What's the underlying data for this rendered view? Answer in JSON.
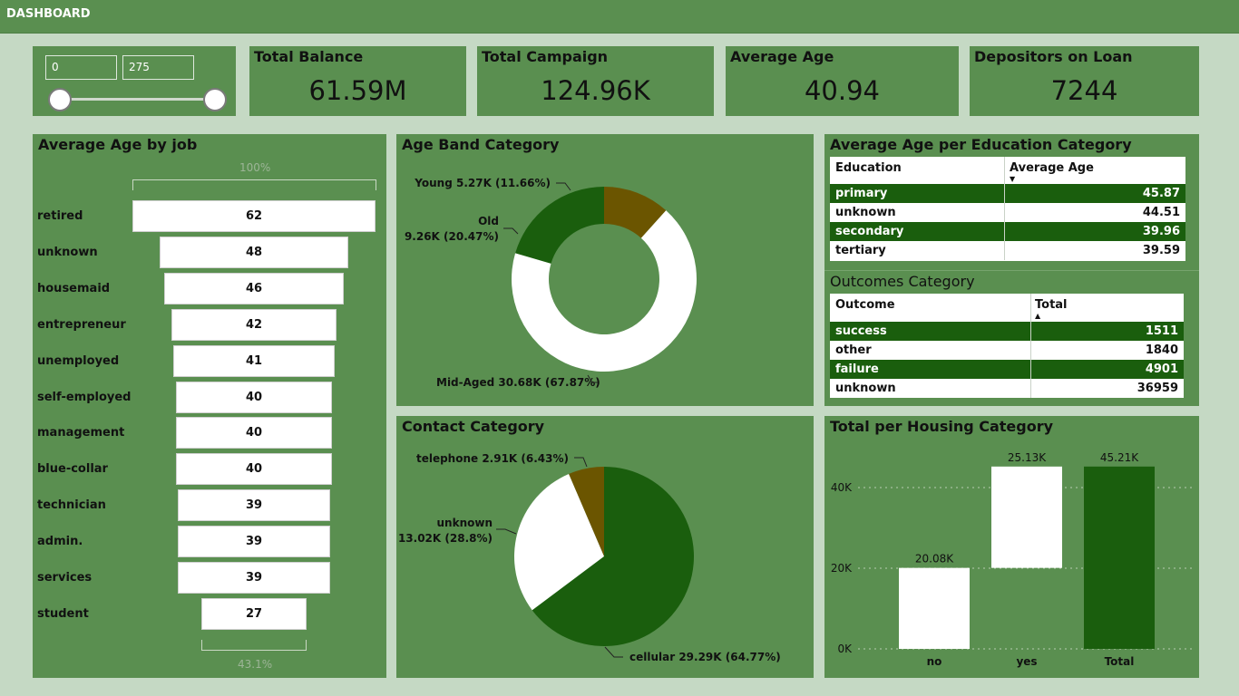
{
  "header": {
    "title": "DASHBOARD"
  },
  "range": {
    "min": "0",
    "max": "275"
  },
  "cards": [
    {
      "title": "Total Balance",
      "value": "61.59M"
    },
    {
      "title": "Total Campaign",
      "value": "124.96K"
    },
    {
      "title": "Average Age",
      "value": "40.94"
    },
    {
      "title": "Depositors on Loan",
      "value": "7244"
    }
  ],
  "colors": {
    "panel": "#5a8f50",
    "background": "#c5d9c4",
    "darkGreen": "#1a5e0d",
    "olive": "#6b5500",
    "white": "#ffffff"
  },
  "chart_data": [
    {
      "type": "funnel",
      "title": "Average Age by job",
      "top_percent": "100%",
      "bottom_percent": "43.1%",
      "categories": [
        "retired",
        "unknown",
        "housemaid",
        "entrepreneur",
        "unemployed",
        "self-employed",
        "management",
        "blue-collar",
        "technician",
        "admin.",
        "services",
        "student"
      ],
      "values": [
        62,
        48,
        46,
        42,
        41,
        40,
        40,
        40,
        39,
        39,
        39,
        27
      ]
    },
    {
      "type": "pie",
      "donut": true,
      "title": "Age Band Category",
      "slices": [
        {
          "name": "Young",
          "label": "Young 5.27K (11.66%)",
          "value": 5.27,
          "percent": 11.66,
          "color": "#6b5500"
        },
        {
          "name": "Mid-Aged",
          "label": "Mid-Aged 30.68K (67.87%)",
          "value": 30.68,
          "percent": 67.87,
          "color": "#ffffff"
        },
        {
          "name": "Old",
          "label_line1": "Old",
          "label_line2": "9.26K (20.47%)",
          "value": 9.26,
          "percent": 20.47,
          "color": "#1a5e0d"
        }
      ]
    },
    {
      "type": "pie",
      "title": "Contact Category",
      "slices": [
        {
          "name": "cellular",
          "label": "cellular 29.29K (64.77%)",
          "value": 29.29,
          "percent": 64.77,
          "color": "#1a5e0d"
        },
        {
          "name": "unknown",
          "label_line1": "unknown",
          "label_line2": "13.02K (28.8%)",
          "value": 13.02,
          "percent": 28.8,
          "color": "#ffffff"
        },
        {
          "name": "telephone",
          "label": "telephone 2.91K (6.43%)",
          "value": 2.91,
          "percent": 6.43,
          "color": "#6b5500"
        }
      ]
    },
    {
      "type": "bar",
      "subtype": "waterfall",
      "title": "Total per Housing Category",
      "categories": [
        "no",
        "yes",
        "Total"
      ],
      "values": [
        20.08,
        25.13,
        45.21
      ],
      "data_labels": [
        "20.08K",
        "25.13K",
        "45.21K"
      ],
      "y_ticks": [
        "0K",
        "20K",
        "40K"
      ],
      "ylim": [
        0,
        45.21
      ]
    }
  ],
  "education_table": {
    "title": "Average Age per Education Category",
    "headers": [
      "Education",
      "Average Age"
    ],
    "rows": [
      {
        "name": "primary",
        "value": "45.87"
      },
      {
        "name": "unknown",
        "value": "44.51"
      },
      {
        "name": "secondary",
        "value": "39.96"
      },
      {
        "name": "tertiary",
        "value": "39.59"
      }
    ]
  },
  "outcomes_table": {
    "title": "Outcomes Category",
    "headers": [
      "Outcome",
      "Total"
    ],
    "rows": [
      {
        "name": "success",
        "value": "1511"
      },
      {
        "name": "other",
        "value": "1840"
      },
      {
        "name": "failure",
        "value": "4901"
      },
      {
        "name": "unknown",
        "value": "36959"
      }
    ]
  }
}
